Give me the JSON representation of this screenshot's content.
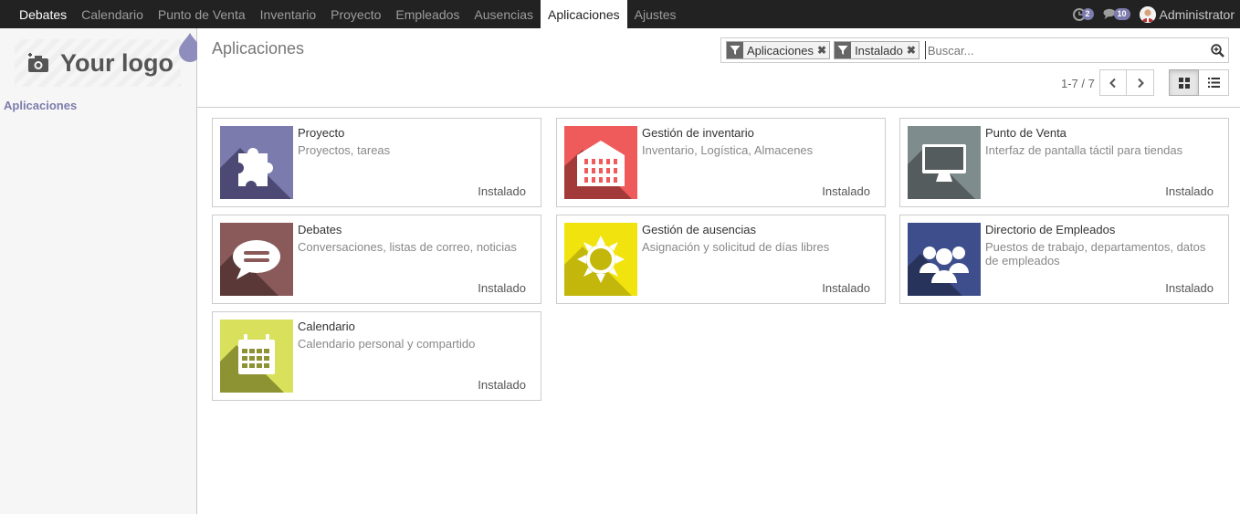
{
  "nav": {
    "brand": "Debates",
    "items": [
      "Calendario",
      "Punto de Venta",
      "Inventario",
      "Proyecto",
      "Empleados",
      "Ausencias",
      "Aplicaciones",
      "Ajustes"
    ],
    "active": "Aplicaciones",
    "activity_count": "2",
    "message_count": "10",
    "user": "Administrator"
  },
  "sidebar": {
    "logo_text": "Your logo",
    "section": "Aplicaciones"
  },
  "control_panel": {
    "title": "Aplicaciones",
    "facets": [
      "Aplicaciones",
      "Instalado"
    ],
    "search_placeholder": "Buscar...",
    "pager": "1-7 / 7"
  },
  "apps": [
    {
      "name": "Proyecto",
      "desc": "Proyectos, tareas",
      "status": "Instalado",
      "color": "#7c7bad",
      "icon": "puzzle-icon"
    },
    {
      "name": "Gestión de inventario",
      "desc": "Inventario, Logística, Almacenes",
      "status": "Instalado",
      "color": "#ef5b5b",
      "icon": "warehouse-icon"
    },
    {
      "name": "Punto de Venta",
      "desc": "Interfaz de pantalla táctil para tiendas",
      "status": "Instalado",
      "color": "#7f8c8d",
      "icon": "monitor-icon"
    },
    {
      "name": "Debates",
      "desc": "Conversaciones, listas de correo, noticias",
      "status": "Instalado",
      "color": "#8a5a5a",
      "icon": "chat-bubble-icon"
    },
    {
      "name": "Gestión de ausencias",
      "desc": "Asignación y solicitud de días libres",
      "status": "Instalado",
      "color": "#f1e30e",
      "icon": "sun-icon"
    },
    {
      "name": "Directorio de Empleados",
      "desc": "Puestos de trabajo, departamentos, datos de empleados",
      "status": "Instalado",
      "color": "#3e4e8c",
      "icon": "people-icon"
    },
    {
      "name": "Calendario",
      "desc": "Calendario personal y compartido",
      "status": "Instalado",
      "color": "#d9e05b",
      "icon": "calendar-icon"
    }
  ]
}
